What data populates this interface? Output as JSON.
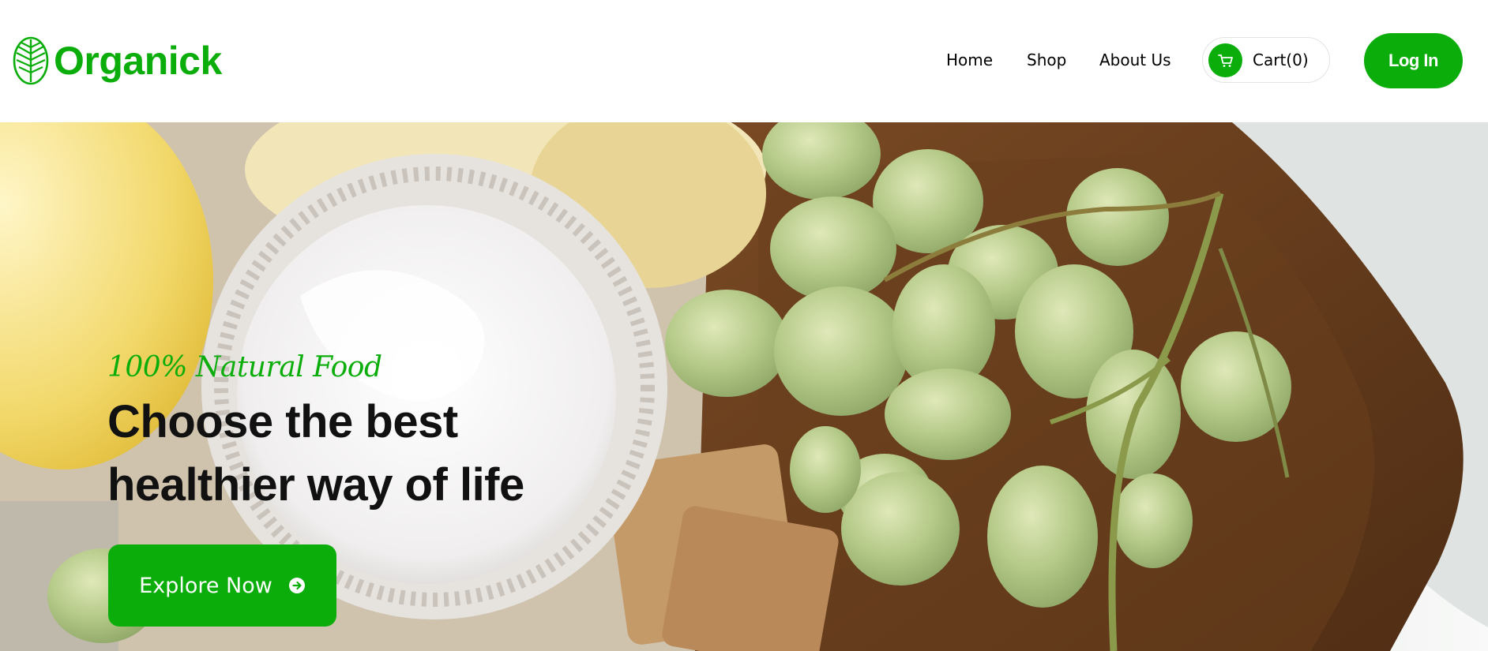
{
  "brand": {
    "name": "Organick",
    "accent_color": "#0aad0a"
  },
  "nav": {
    "items": [
      {
        "label": "Home"
      },
      {
        "label": "Shop"
      },
      {
        "label": "About Us"
      }
    ]
  },
  "cart": {
    "label": "Cart(0)",
    "icon": "cart-icon"
  },
  "auth": {
    "login_label": "Log In"
  },
  "hero": {
    "tagline": "100% Natural Food",
    "headline_line1": "Choose the best",
    "headline_line2": "healthier way of life",
    "cta_label": "Explore Now",
    "cta_icon": "arrow-right-circle-icon",
    "image": "photo of cream in a glass bowl, green grapes and crackers on a wooden board"
  }
}
